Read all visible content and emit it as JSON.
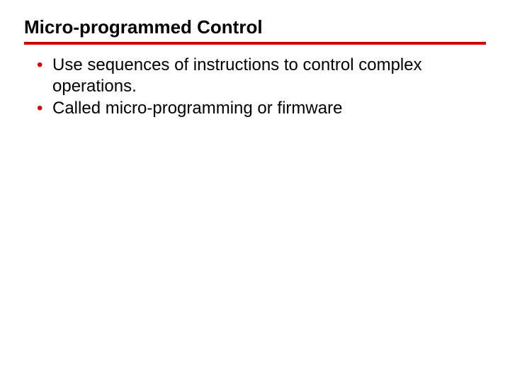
{
  "colors": {
    "accent": "#cc0000"
  },
  "slide": {
    "title": "Micro-programmed Control",
    "bullets": [
      "Use sequences of instructions to control complex operations.",
      "Called micro-programming or firmware"
    ]
  }
}
